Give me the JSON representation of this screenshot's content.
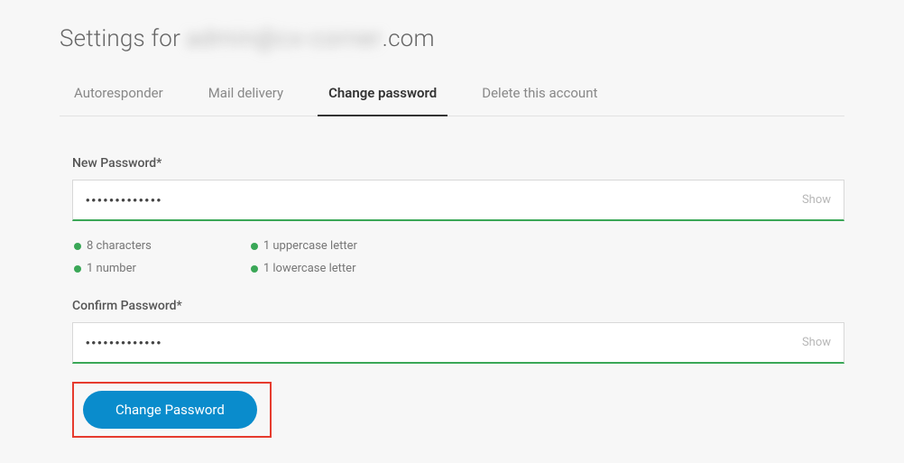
{
  "title_prefix": "Settings for ",
  "title_blurred": "admin@cx-corner",
  "title_suffix": ".com",
  "tabs": [
    {
      "label": "Autoresponder",
      "active": false
    },
    {
      "label": "Mail delivery",
      "active": false
    },
    {
      "label": "Change password",
      "active": true
    },
    {
      "label": "Delete this account",
      "active": false
    }
  ],
  "new_password": {
    "label": "New Password*",
    "value": "•••••••••••••",
    "show_toggle": "Show"
  },
  "confirm_password": {
    "label": "Confirm Password*",
    "value": "•••••••••••••",
    "show_toggle": "Show"
  },
  "requirements": {
    "col1": [
      "8 characters",
      "1 number"
    ],
    "col2": [
      "1 uppercase letter",
      "1 lowercase letter"
    ]
  },
  "submit_label": "Change Password"
}
